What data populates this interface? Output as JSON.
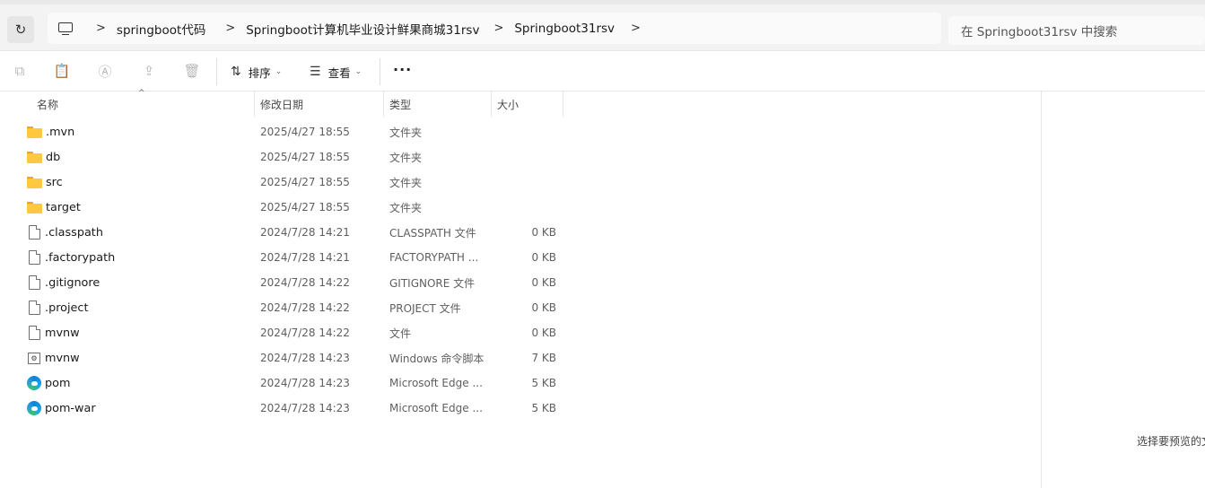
{
  "address_bar": {
    "breadcrumb": [
      "springboot代码",
      "Springboot计算机毕业设计鲜果商城31rsv",
      "Springboot31rsv"
    ],
    "search_placeholder": "在 Springboot31rsv 中搜索"
  },
  "toolbar": {
    "sort_label": "排序",
    "view_label": "查看",
    "more_label": "···"
  },
  "columns": {
    "name": "名称",
    "date": "修改日期",
    "type": "类型",
    "size": "大小"
  },
  "files": [
    {
      "name": ".mvn",
      "date": "2025/4/27 18:55",
      "type": "文件夹",
      "size": "",
      "icon": "folder-icon"
    },
    {
      "name": "db",
      "date": "2025/4/27 18:55",
      "type": "文件夹",
      "size": "",
      "icon": "folder-icon"
    },
    {
      "name": "src",
      "date": "2025/4/27 18:55",
      "type": "文件夹",
      "size": "",
      "icon": "folder-icon"
    },
    {
      "name": "target",
      "date": "2025/4/27 18:55",
      "type": "文件夹",
      "size": "",
      "icon": "folder-icon"
    },
    {
      "name": ".classpath",
      "date": "2024/7/28 14:21",
      "type": "CLASSPATH 文件",
      "size": "0 KB",
      "icon": "file-icon"
    },
    {
      "name": ".factorypath",
      "date": "2024/7/28 14:21",
      "type": "FACTORYPATH ...",
      "size": "0 KB",
      "icon": "file-icon"
    },
    {
      "name": ".gitignore",
      "date": "2024/7/28 14:22",
      "type": "GITIGNORE 文件",
      "size": "0 KB",
      "icon": "file-icon"
    },
    {
      "name": ".project",
      "date": "2024/7/28 14:22",
      "type": "PROJECT 文件",
      "size": "0 KB",
      "icon": "file-icon"
    },
    {
      "name": "mvnw",
      "date": "2024/7/28 14:22",
      "type": "文件",
      "size": "0 KB",
      "icon": "file-icon"
    },
    {
      "name": "mvnw",
      "date": "2024/7/28 14:23",
      "type": "Windows 命令脚本",
      "size": "7 KB",
      "icon": "cmd-script-icon"
    },
    {
      "name": "pom",
      "date": "2024/7/28 14:23",
      "type": "Microsoft Edge ...",
      "size": "5 KB",
      "icon": "edge-icon"
    },
    {
      "name": "pom-war",
      "date": "2024/7/28 14:23",
      "type": "Microsoft Edge ...",
      "size": "5 KB",
      "icon": "edge-icon"
    }
  ],
  "preview": {
    "text": "选择要预览的文"
  }
}
